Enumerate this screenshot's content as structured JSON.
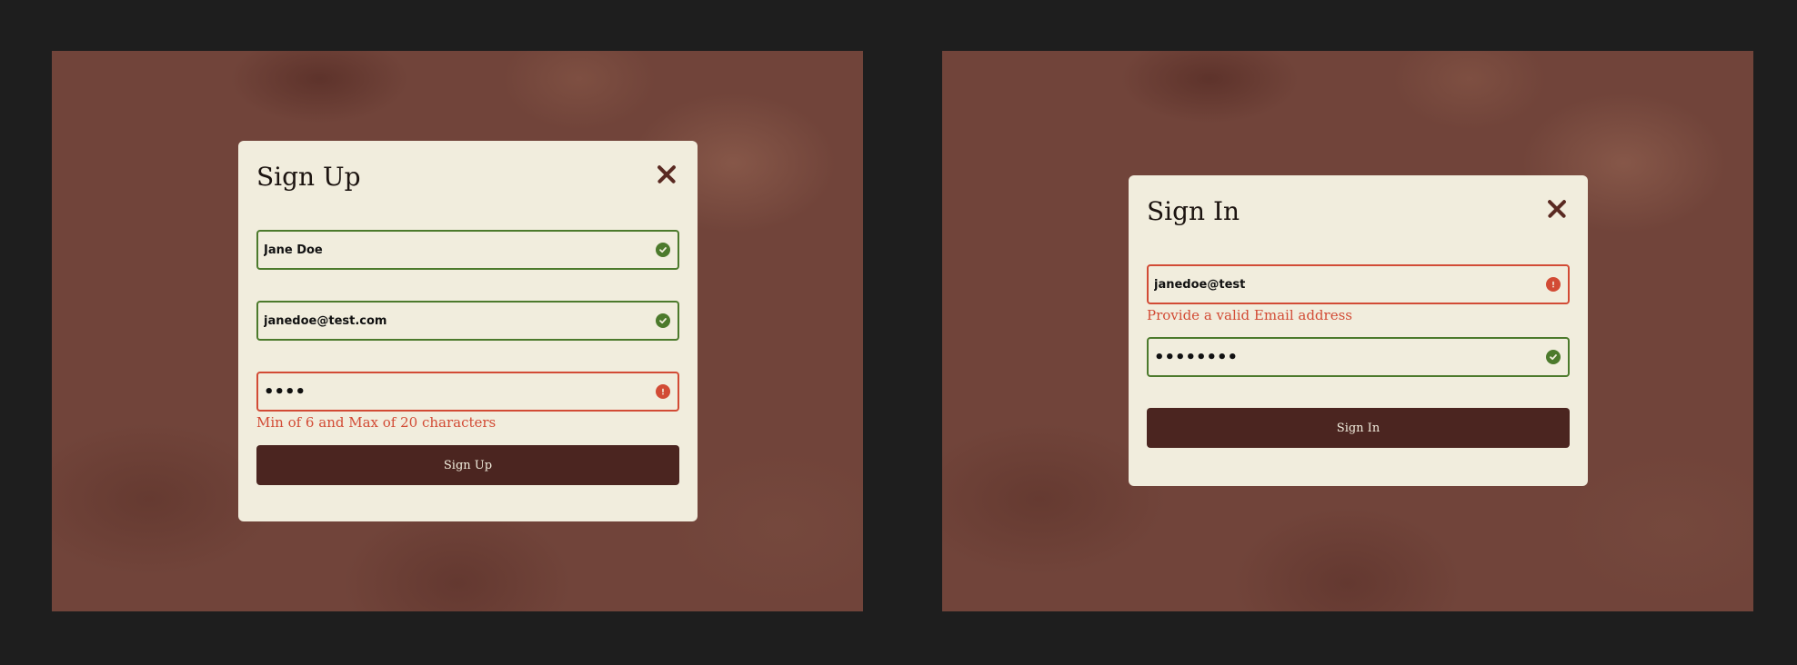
{
  "colors": {
    "page_background": "#1e1e1e",
    "panel_background": "#71443a",
    "modal_background": "#f1eddd",
    "valid_green": "#4c7a2c",
    "error_red": "#d24b35",
    "button_dark": "#4b2520"
  },
  "signup": {
    "title": "Sign Up",
    "close_icon": "close-icon",
    "name": {
      "value": "Jane Doe",
      "status": "valid",
      "icon": "check-circle-icon"
    },
    "email": {
      "value": "janedoe@test.com",
      "status": "valid",
      "icon": "check-circle-icon"
    },
    "password": {
      "value": "••••",
      "status": "error",
      "icon": "exclamation-circle-icon"
    },
    "password_error": "Min of 6 and Max of 20 characters",
    "submit_label": "Sign Up"
  },
  "signin": {
    "title": "Sign In",
    "close_icon": "close-icon",
    "email": {
      "value": "janedoe@test",
      "status": "error",
      "icon": "exclamation-circle-icon"
    },
    "email_error": "Provide a valid Email address",
    "password": {
      "value": "••••••••",
      "status": "valid",
      "icon": "check-circle-icon"
    },
    "submit_label": "Sign In"
  }
}
